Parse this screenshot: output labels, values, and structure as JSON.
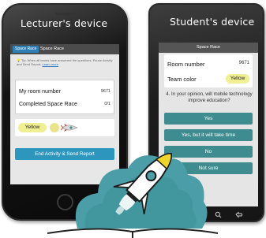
{
  "lecturer": {
    "device_label": "Lecturer's device",
    "top_bar": {
      "active_tab": "Space Race",
      "title": "Space Race"
    },
    "tip": {
      "text": "Tip: When all teams have answered the questions, Pause Activity and Send Report.",
      "link": "Learn more"
    },
    "stats": {
      "room_number_label": "My room number",
      "room_number_value": "9671",
      "completed_label": "Completed Space Race",
      "completed_value": "0/1"
    },
    "team": {
      "color_name": "Yellow",
      "color_hex": "#f1ef93"
    },
    "end_button_label": "End Activity & Send Report"
  },
  "student": {
    "device_label": "Student's device",
    "top_bar_title": "Space Race",
    "room_number_label": "Room number",
    "room_number_value": "9671",
    "team_color_label": "Team color",
    "team_color_value": "Yellow",
    "question": "4. In your opinion, will mobile technology improve education?",
    "answers": [
      "Yes",
      "Yes, but it will take time",
      "No",
      "Not sure"
    ]
  },
  "colors": {
    "accent_teal": "#3e8c8f",
    "accent_blue": "#2d96bd",
    "team_yellow": "#f1ef93",
    "cloud": "#4b9ea7"
  },
  "icons": {
    "nav_home": "home-icon",
    "nav_search": "search-icon",
    "nav_back": "back-icon",
    "logo": "rocket-cloud-logo"
  }
}
